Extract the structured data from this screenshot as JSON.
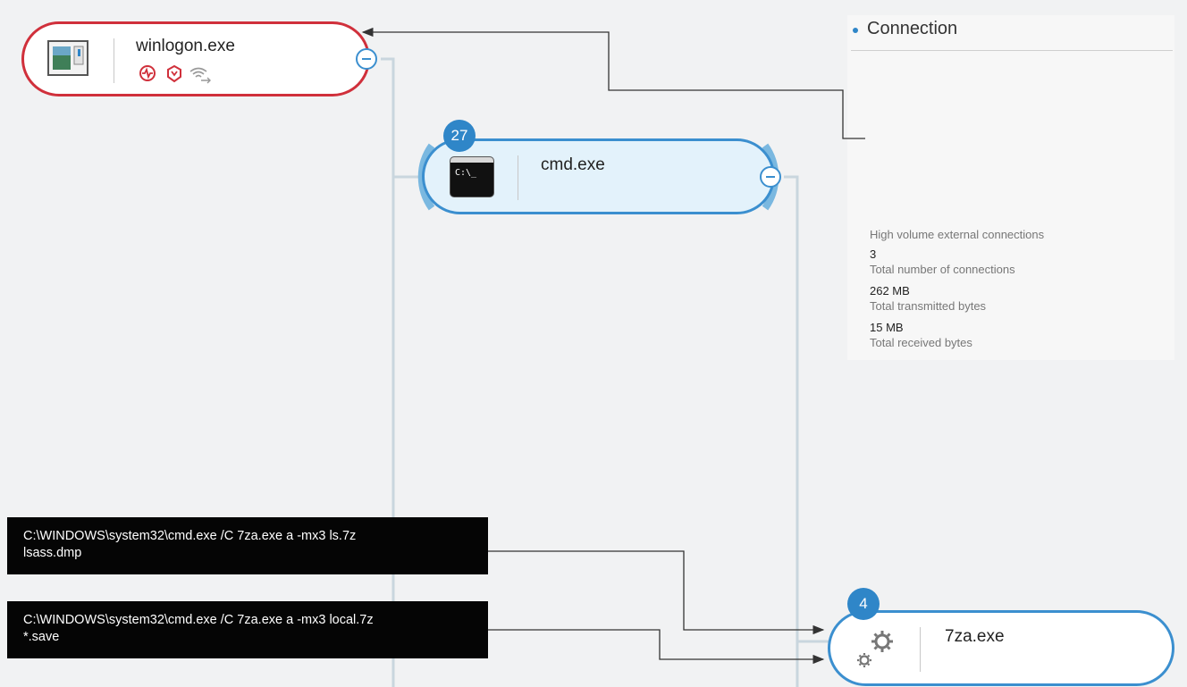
{
  "nodes": {
    "winlogon": {
      "name": "winlogon.exe",
      "border_color": "#d0303b",
      "status_icons": [
        "activity-icon",
        "threat-shield-icon",
        "network-icon"
      ]
    },
    "cmd": {
      "name": "cmd.exe",
      "badge": "27",
      "icon_text": "C:\\_"
    },
    "za": {
      "name": "7za.exe",
      "badge": "4"
    }
  },
  "panel": {
    "title": "Connection",
    "subtitle": "High volume external connections",
    "stats": [
      {
        "value": "3",
        "label": "Total number of connections"
      },
      {
        "value": "262 MB",
        "label": "Total transmitted bytes"
      },
      {
        "value": "15 MB",
        "label": "Total received bytes"
      }
    ]
  },
  "command_lines": [
    {
      "line1": "C:\\WINDOWS\\system32\\cmd.exe /C 7za.exe a -mx3 ls.7z",
      "line2": "lsass.dmp"
    },
    {
      "line1": "C:\\WINDOWS\\system32\\cmd.exe /C 7za.exe a -mx3 local.7z",
      "line2": "*.save"
    }
  ],
  "colors": {
    "alert": "#d0303b",
    "accent": "#2f86c8",
    "tree_line": "#c9d6de"
  }
}
